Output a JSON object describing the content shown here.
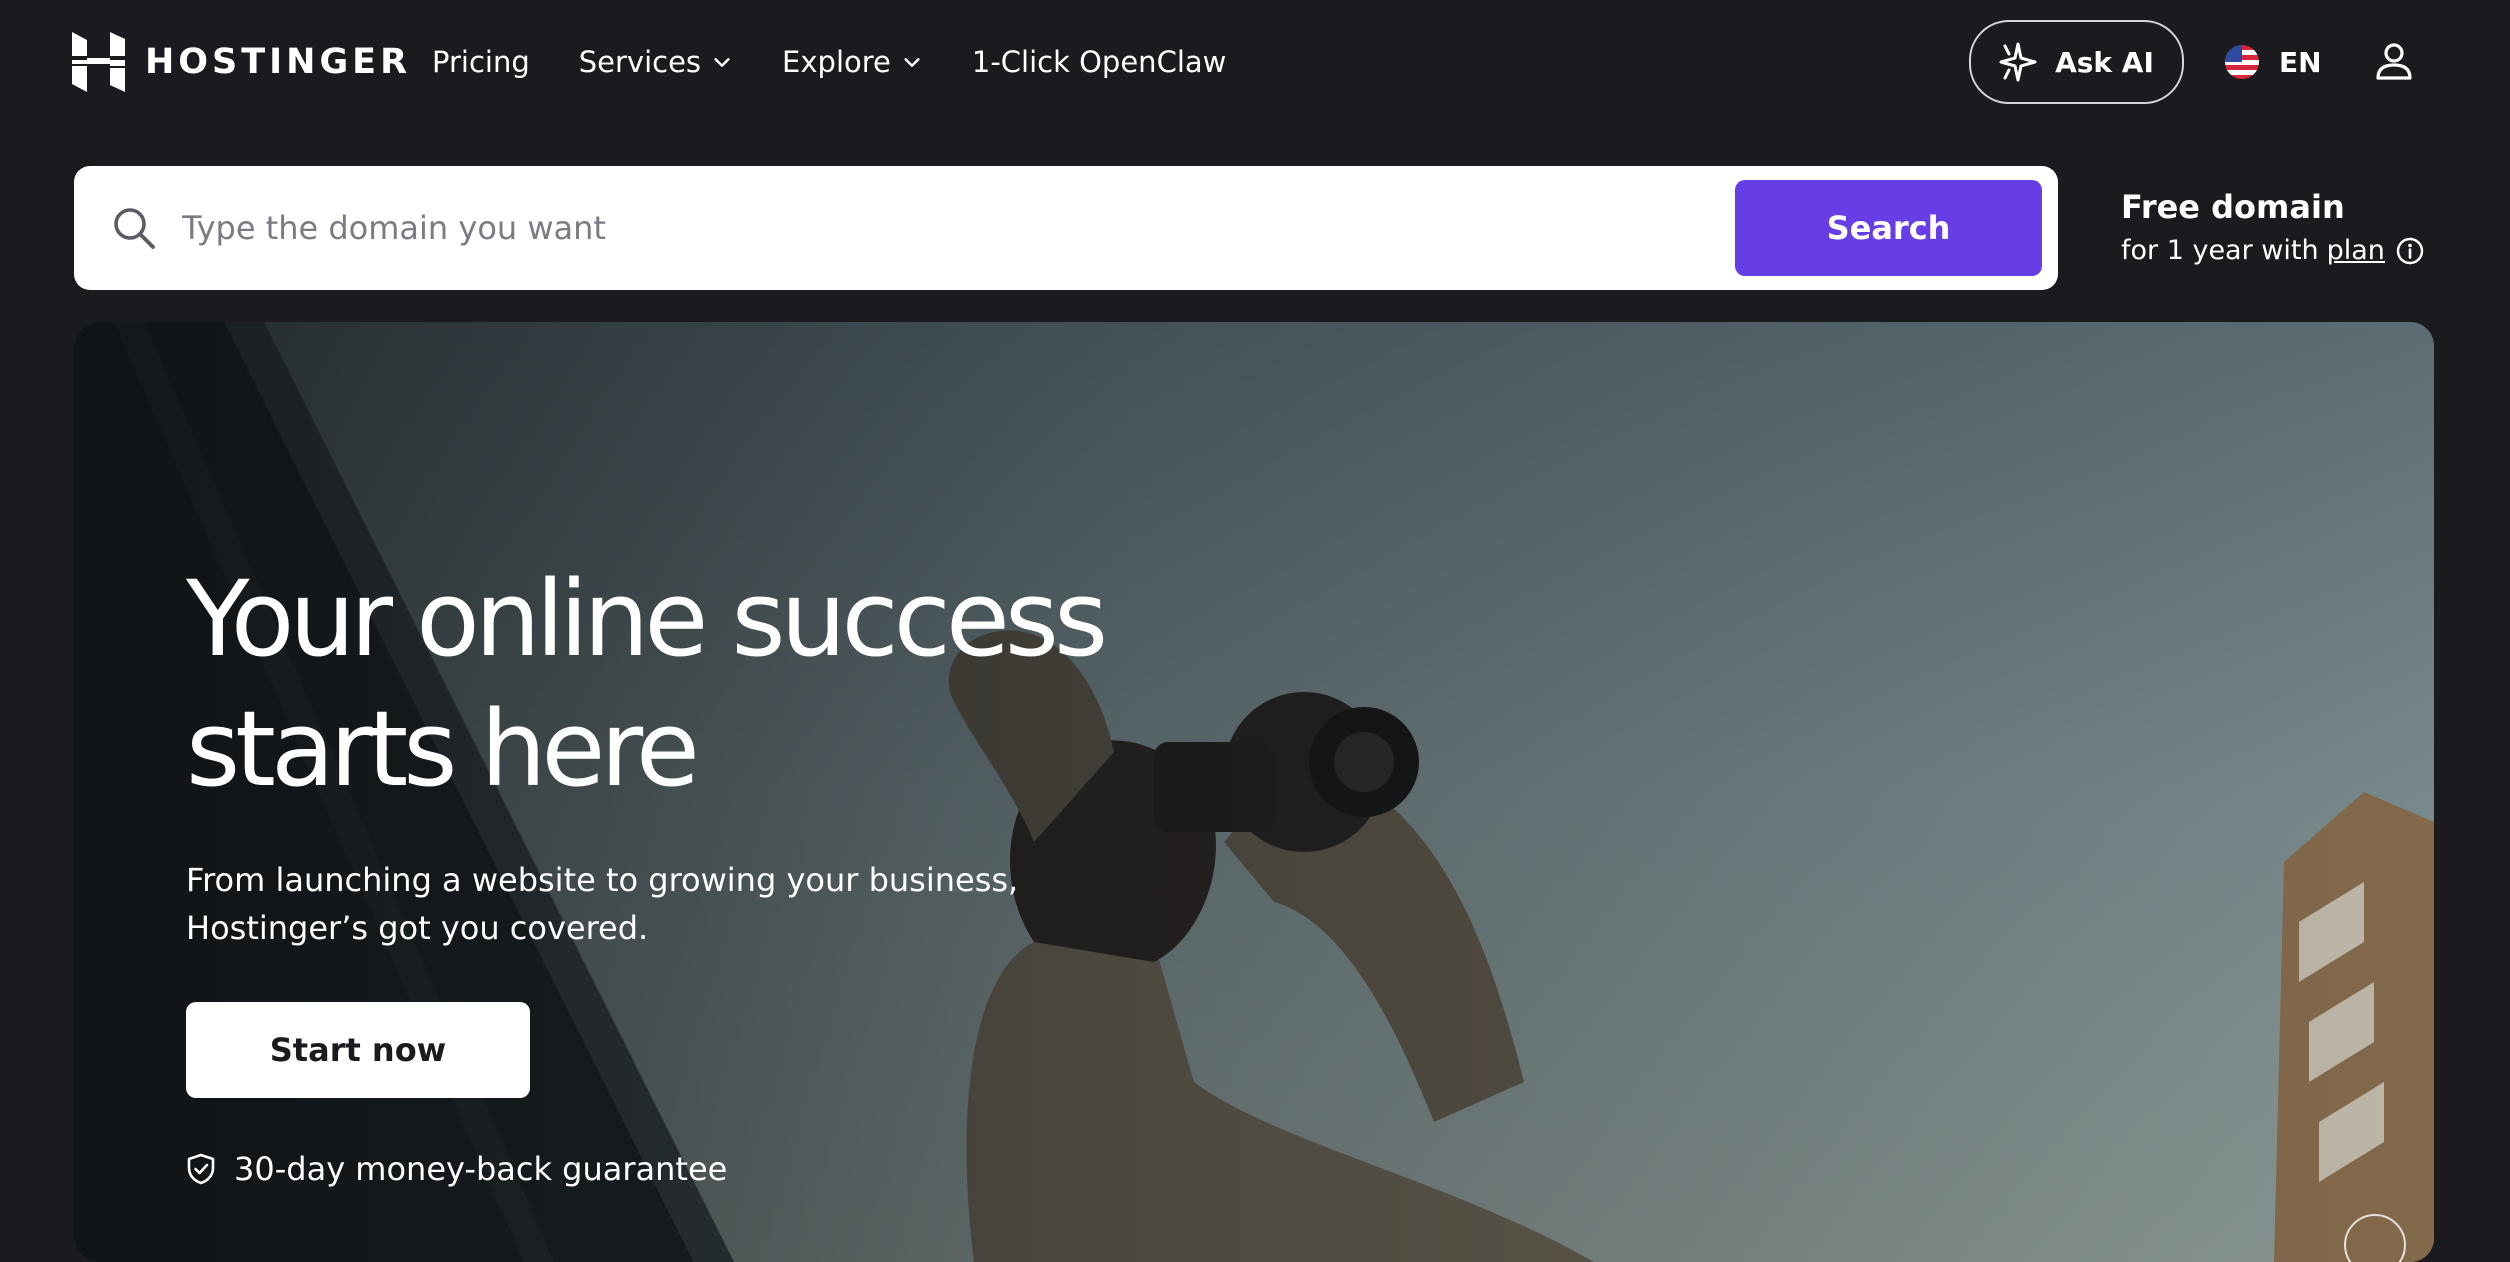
{
  "header": {
    "logo_text": "HOSTINGER",
    "nav": [
      {
        "label": "Pricing",
        "has_dropdown": false
      },
      {
        "label": "Services",
        "has_dropdown": true
      },
      {
        "label": "Explore",
        "has_dropdown": true
      },
      {
        "label": "1-Click OpenClaw",
        "has_dropdown": false
      }
    ],
    "ask_ai_label": "Ask AI",
    "language_code": "EN"
  },
  "search": {
    "placeholder": "Type the domain you want",
    "button_label": "Search"
  },
  "free_domain": {
    "title": "Free domain",
    "subtitle": "for 1 year with",
    "link_text": "plan"
  },
  "hero": {
    "title_line1": "Your online success",
    "title_line2": "starts here",
    "subtitle": "From launching a website to growing your business, Hostinger’s got you covered.",
    "cta_label": "Start now",
    "guarantee": "30-day money-back guarantee"
  },
  "colors": {
    "page_background": "#1b1a1f",
    "brand_purple": "#673de6",
    "text_light": "#ffffff"
  },
  "icons": [
    "hostinger-logo-icon",
    "chevron-down-icon",
    "sparkle-ai-icon",
    "us-flag-icon",
    "user-icon",
    "search-icon",
    "info-icon",
    "shield-check-icon"
  ]
}
